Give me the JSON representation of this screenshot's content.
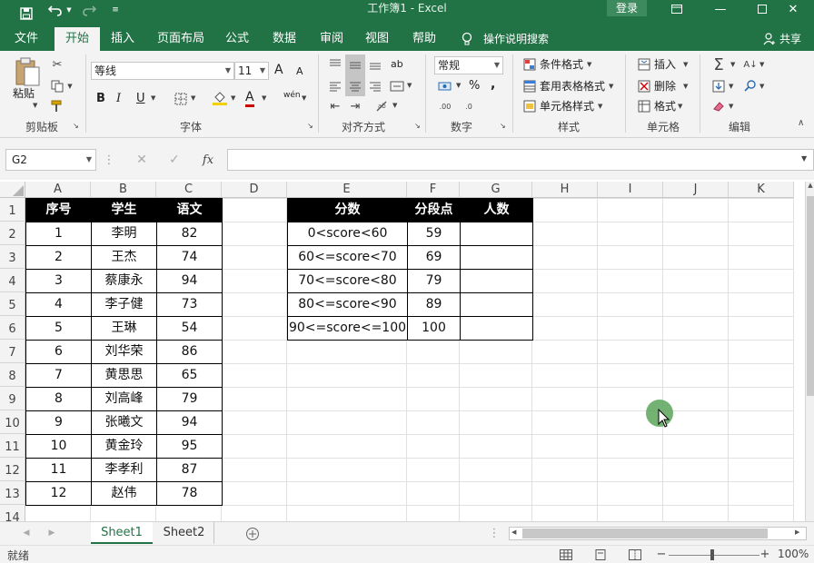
{
  "titlebar": {
    "title": "工作簿1  -  Excel",
    "login": "登录",
    "icons": [
      "save-icon",
      "undo-icon",
      "redo-icon",
      "customize-icon"
    ]
  },
  "tabs": [
    "文件",
    "开始",
    "插入",
    "页面布局",
    "公式",
    "数据",
    "审阅",
    "视图",
    "帮助"
  ],
  "active_tab": "开始",
  "tell_me": "操作说明搜索",
  "share": "共享",
  "ribbon": {
    "clipboard": {
      "paste": "粘贴",
      "label": "剪贴板"
    },
    "font": {
      "name": "等线",
      "size": "11",
      "bold": "B",
      "italic": "I",
      "underline": "U",
      "label": "字体",
      "grow": "A",
      "shrink": "A",
      "wen": "wén",
      "color_letter": "A"
    },
    "alignment": {
      "label": "对齐方式",
      "wrap": "ab"
    },
    "number": {
      "format": "常规",
      "label": "数字",
      "percent": "%",
      "comma": ","
    },
    "styles": {
      "cond": "条件格式",
      "table": "套用表格格式",
      "cell": "单元格样式",
      "label": "样式"
    },
    "cells": {
      "insert": "插入",
      "delete": "删除",
      "format": "格式",
      "label": "单元格"
    },
    "editing": {
      "label": "编辑"
    },
    "colors": {
      "accent": "#217346",
      "ribbon_bg": "#f3f3f3"
    }
  },
  "formula_bar": {
    "name_box": "G2",
    "fx": "fx",
    "formula": ""
  },
  "columns": [
    "A",
    "B",
    "C",
    "D",
    "E",
    "F",
    "G",
    "H",
    "I",
    "J",
    "K"
  ],
  "rows": [
    "1",
    "2",
    "3",
    "4",
    "5",
    "6",
    "7",
    "8",
    "9",
    "10",
    "11",
    "12",
    "13",
    "14"
  ],
  "table1": {
    "headers": [
      "序号",
      "学生",
      "语文"
    ],
    "rows": [
      [
        "1",
        "李明",
        "82"
      ],
      [
        "2",
        "王杰",
        "74"
      ],
      [
        "3",
        "蔡康永",
        "94"
      ],
      [
        "4",
        "李子健",
        "73"
      ],
      [
        "5",
        "王琳",
        "54"
      ],
      [
        "6",
        "刘华荣",
        "86"
      ],
      [
        "7",
        "黄思思",
        "65"
      ],
      [
        "8",
        "刘高峰",
        "79"
      ],
      [
        "9",
        "张曦文",
        "94"
      ],
      [
        "10",
        "黄金玲",
        "95"
      ],
      [
        "11",
        "李孝利",
        "87"
      ],
      [
        "12",
        "赵伟",
        "78"
      ]
    ]
  },
  "table2": {
    "headers": [
      "分数",
      "分段点",
      "人数"
    ],
    "rows": [
      [
        "0<score<60",
        "59",
        ""
      ],
      [
        "60<=score<70",
        "69",
        ""
      ],
      [
        "70<=score<80",
        "79",
        ""
      ],
      [
        "80<=score<90",
        "89",
        ""
      ],
      [
        "90<=score<=100",
        "100",
        ""
      ]
    ]
  },
  "sheets": [
    "Sheet1",
    "Sheet2"
  ],
  "active_sheet": "Sheet1",
  "status": {
    "ready": "就绪",
    "zoom": "100%"
  }
}
